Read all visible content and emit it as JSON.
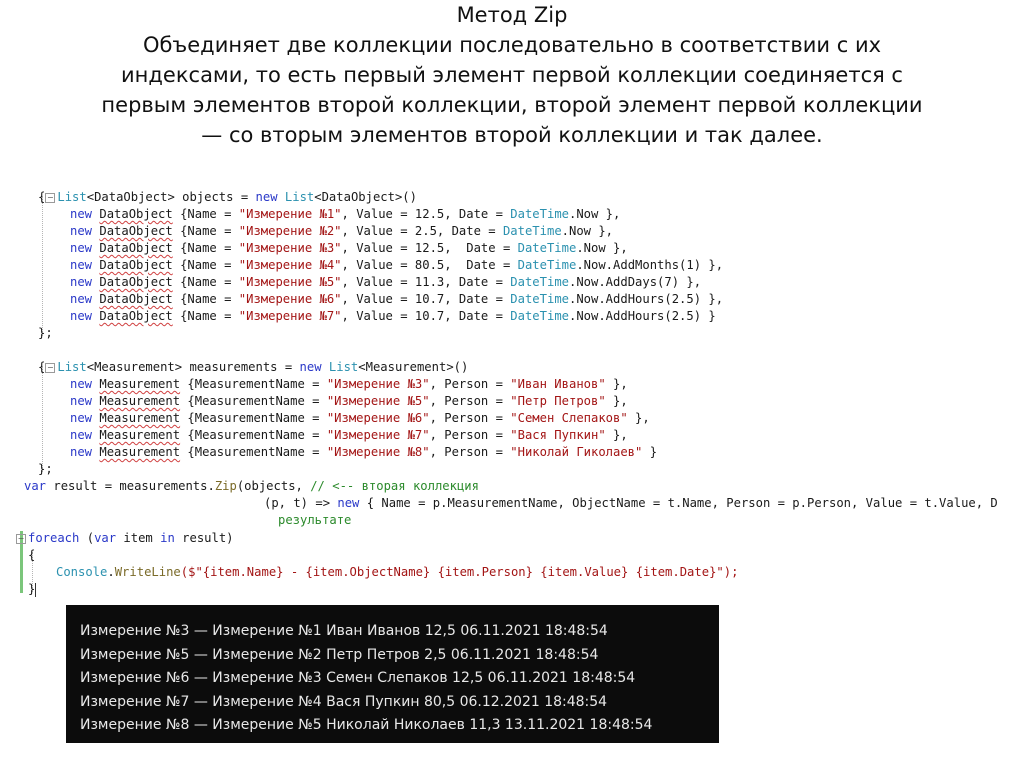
{
  "slide": {
    "title": "Метод Zip",
    "description_lines": [
      "Объединяет две коллекции последовательно в соответствии с их",
      "индексами, то есть первый элемент первой коллекции соединяется с",
      "первым элементов второй коллекции, второй элемент первой коллекции",
      "— со вторым элементов второй коллекции и так далее."
    ]
  },
  "code": {
    "objects_decl": {
      "type": "List",
      "generic": "DataObject",
      "name": "objects",
      "assign": "=",
      "new_kw": "new",
      "ctor": "List",
      "ctor_generic": "DataObject"
    },
    "data_objects": [
      {
        "name": "\"Измерение №1\"",
        "value": "12.5",
        "date_tail": ".Now },"
      },
      {
        "name": "\"Измерение №2\"",
        "value": "2.5",
        "date_tail": ".Now },"
      },
      {
        "name": "\"Измерение №3\"",
        "value": "12.5",
        "date_tail": ".Now },"
      },
      {
        "name": "\"Измерение №4\"",
        "value": "80.5",
        "date_tail": ".Now.AddMonths(1) },"
      },
      {
        "name": "\"Измерение №5\"",
        "value": "11.3",
        "date_tail": ".Now.AddDays(7) },"
      },
      {
        "name": "\"Измерение №6\"",
        "value": "10.7",
        "date_tail": ".Now.AddHours(2.5) },"
      },
      {
        "name": "\"Измерение №7\"",
        "value": "10.7",
        "date_tail": ".Now.AddHours(2.5) }"
      }
    ],
    "measurements_decl": {
      "type": "List",
      "generic": "Measurement",
      "name": "measurements"
    },
    "measurements": [
      {
        "name": "\"Измерение №3\"",
        "person": "\"Иван Иванов\"",
        "tail": " },"
      },
      {
        "name": "\"Измерение №5\"",
        "person": "\"Петр Петров\"",
        "tail": " },"
      },
      {
        "name": "\"Измерение №6\"",
        "person": "\"Семен Слепаков\"",
        "tail": " },"
      },
      {
        "name": "\"Измерение №7\"",
        "person": "\"Вася Пупкин\"",
        "tail": " },"
      },
      {
        "name": "\"Измерение №8\"",
        "person": "\"Николай Гиколаев\"",
        "tail": " }"
      }
    ],
    "zip_line": {
      "var_kw": "var",
      "name": "result",
      "source": "measurements",
      "method": "Zip",
      "args": "(objects,",
      "comment": "// <-- вторая коллекция"
    },
    "lambda_line": {
      "params": "(p, t) => ",
      "new_kw": "new",
      "body": " { Name = p.MeasurementName, ObjectName = t.Name, Person = p.Person, Value = t.Value, D"
    },
    "comment_cont": "результате",
    "foreach_line": {
      "kw": "foreach",
      "var_kw": "var",
      "item": "item",
      "in_kw": "in",
      "collection": "result)"
    },
    "console_call": {
      "cls": "Console",
      "method": "WriteLine",
      "format": "($\"{item.Name} - {item.ObjectName} {item.Person} {item.Value} {item.Date}\");"
    }
  },
  "console": {
    "lines": [
      "Измерение №3 — Измерение №1 Иван Иванов 12,5 06.11.2021 18:48:54",
      "Измерение №5 — Измерение №2 Петр Петров 2,5 06.11.2021 18:48:54",
      "Измерение №6 — Измерение №3 Семен Слепаков 12,5 06.11.2021 18:48:54",
      "Измерение №7 — Измерение №4 Вася Пупкин 80,5 06.12.2021 18:48:54",
      "Измерение №8 — Измерение №5 Николай Николаев 11,3 13.11.2021 18:48:54"
    ]
  },
  "colors": {
    "keyword": "#2a38c8",
    "string": "#a31515",
    "comment": "#2b8a2b",
    "type_builtin": "#2b91af",
    "console_bg": "#0c0c0c",
    "console_text": "#e8e8e8"
  }
}
